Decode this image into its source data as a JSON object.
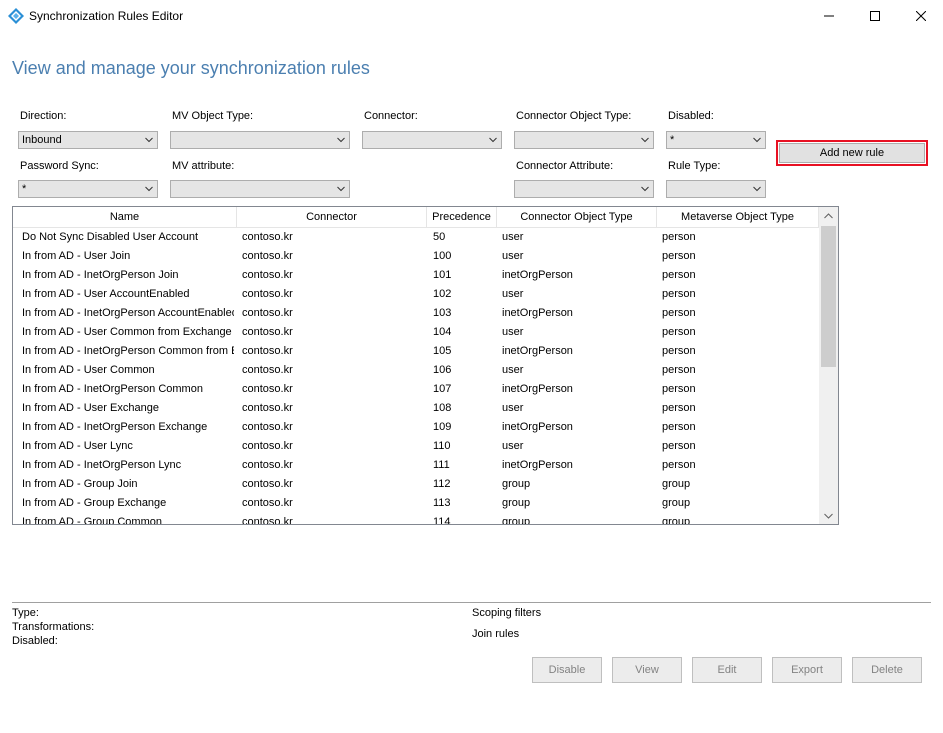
{
  "window": {
    "title": "Synchronization Rules Editor"
  },
  "heading": "View and manage your synchronization rules",
  "filters": {
    "direction": {
      "label": "Direction:",
      "value": "Inbound"
    },
    "mv_object_type": {
      "label": "MV Object Type:",
      "value": ""
    },
    "connector": {
      "label": "Connector:",
      "value": ""
    },
    "connector_object_type": {
      "label": "Connector Object Type:",
      "value": ""
    },
    "disabled": {
      "label": "Disabled:",
      "value": "*"
    },
    "password_sync": {
      "label": "Password Sync:",
      "value": "*"
    },
    "mv_attribute": {
      "label": "MV attribute:",
      "value": ""
    },
    "connector_attribute": {
      "label": "Connector Attribute:",
      "value": ""
    },
    "rule_type": {
      "label": "Rule Type:",
      "value": ""
    }
  },
  "add_rule_label": "Add new rule",
  "grid": {
    "columns": [
      "Name",
      "Connector",
      "Precedence",
      "Connector Object Type",
      "Metaverse Object Type"
    ],
    "rows": [
      [
        "Do Not Sync Disabled User Account",
        "contoso.kr",
        "50",
        "user",
        "person"
      ],
      [
        "In from AD - User Join",
        "contoso.kr",
        "100",
        "user",
        "person"
      ],
      [
        "In from AD - InetOrgPerson Join",
        "contoso.kr",
        "101",
        "inetOrgPerson",
        "person"
      ],
      [
        "In from AD - User AccountEnabled",
        "contoso.kr",
        "102",
        "user",
        "person"
      ],
      [
        "In from AD - InetOrgPerson AccountEnabled",
        "contoso.kr",
        "103",
        "inetOrgPerson",
        "person"
      ],
      [
        "In from AD - User Common from Exchange",
        "contoso.kr",
        "104",
        "user",
        "person"
      ],
      [
        "In from AD - InetOrgPerson Common from E:",
        "contoso.kr",
        "105",
        "inetOrgPerson",
        "person"
      ],
      [
        "In from AD - User Common",
        "contoso.kr",
        "106",
        "user",
        "person"
      ],
      [
        "In from AD - InetOrgPerson Common",
        "contoso.kr",
        "107",
        "inetOrgPerson",
        "person"
      ],
      [
        "In from AD - User Exchange",
        "contoso.kr",
        "108",
        "user",
        "person"
      ],
      [
        "In from AD - InetOrgPerson Exchange",
        "contoso.kr",
        "109",
        "inetOrgPerson",
        "person"
      ],
      [
        "In from AD - User Lync",
        "contoso.kr",
        "110",
        "user",
        "person"
      ],
      [
        "In from AD - InetOrgPerson Lync",
        "contoso.kr",
        "111",
        "inetOrgPerson",
        "person"
      ],
      [
        "In from AD - Group Join",
        "contoso.kr",
        "112",
        "group",
        "group"
      ],
      [
        "In from AD - Group Exchange",
        "contoso.kr",
        "113",
        "group",
        "group"
      ],
      [
        "In from AD - Group Common",
        "contoso.kr",
        "114",
        "group",
        "group"
      ]
    ]
  },
  "details": {
    "type_label": "Type:",
    "transformations_label": "Transformations:",
    "disabled_label": "Disabled:",
    "scoping_filters": "Scoping filters",
    "join_rules": "Join rules"
  },
  "buttons": {
    "disable": "Disable",
    "view": "View",
    "edit": "Edit",
    "export": "Export",
    "delete": "Delete"
  },
  "colors": {
    "heading": "#4b7fb0",
    "accent_border": "#e81123",
    "app_icon": "#2a8fd6"
  },
  "icons": {
    "app": "sync-diamond-icon",
    "minimize": "minimize-icon",
    "maximize": "maximize-icon",
    "close": "close-icon"
  }
}
